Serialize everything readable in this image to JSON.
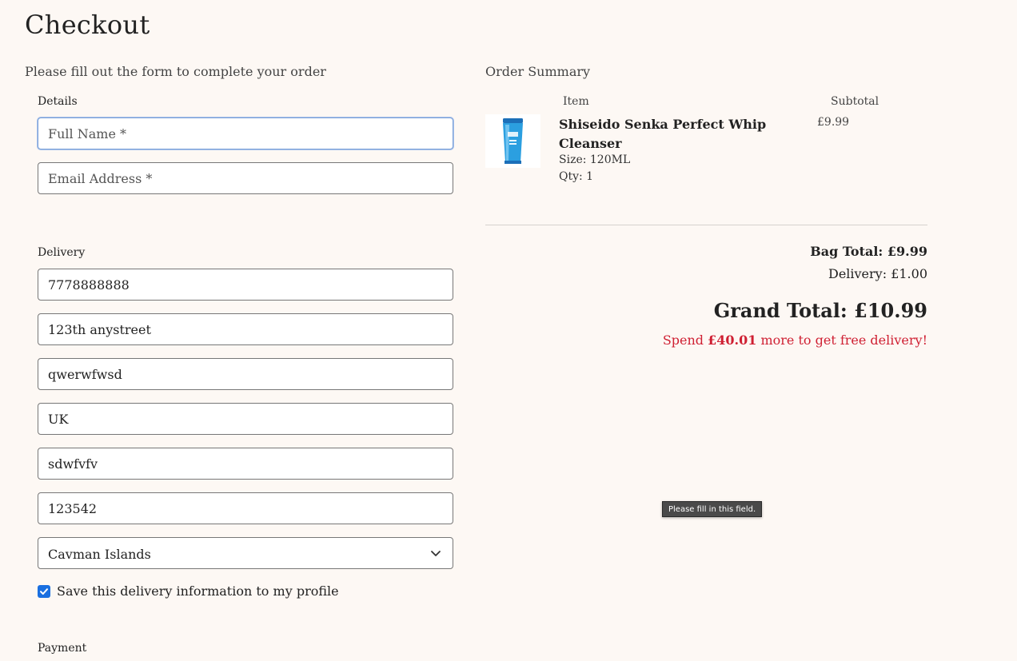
{
  "header": {
    "title": "Checkout",
    "subtitle": "Please fill out the form to complete your order"
  },
  "details": {
    "label": "Details",
    "full_name_placeholder": "Full Name *",
    "email_placeholder": "Email Address *"
  },
  "delivery": {
    "label": "Delivery",
    "phone_value": "7778888888",
    "street1_value": "123th anystreet",
    "street2_value": "qwerwfwsd",
    "town_value": "UK",
    "county_value": "sdwfvfv",
    "postcode_value": "123542",
    "country_selected": "Cavman Islands",
    "save_info_label": "Save this delivery information to my profile",
    "save_info_checked": true
  },
  "payment": {
    "label": "Payment"
  },
  "summary": {
    "title": "Order Summary",
    "col_item": "Item",
    "col_subtotal": "Subtotal",
    "item": {
      "name": "Shiseido Senka Perfect Whip Cleanser",
      "size": "Size: 120ML",
      "qty": "Qty: 1",
      "price": "£9.99"
    },
    "bag_total": "Bag Total: £9.99",
    "delivery_total": "Delivery: £1.00",
    "grand_total": "Grand Total: £10.99",
    "free_delivery_prefix": "Spend ",
    "free_delivery_amount": "£40.01",
    "free_delivery_suffix": " more to get free delivery!"
  },
  "tooltip": {
    "text": "Please fill in this field."
  },
  "colors": {
    "background": "#fdf8f4",
    "checkbox_accent": "#1a6fe0",
    "alert_red": "#cf1f32"
  },
  "icons": {
    "select_chevron": "chevron-down-icon",
    "checkbox": "check-icon"
  }
}
